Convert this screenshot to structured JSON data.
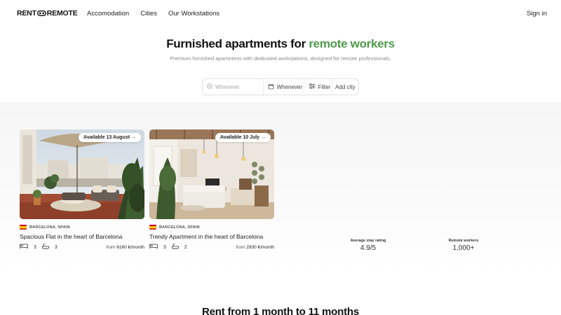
{
  "brand": {
    "left": "RENT",
    "right": "REMOTE"
  },
  "nav": {
    "links": [
      "Accomodation",
      "Cities",
      "Our Workstations"
    ],
    "signin": "Sign in"
  },
  "hero": {
    "title_prefix": "Furnished apartments for ",
    "title_accent": "remote workers",
    "subtitle": "Premium furnished apartments with dedicated workstations, designed for remote professionals.",
    "accent_color": "#4f9a4a"
  },
  "search": {
    "where_placeholder": "Wherever",
    "when_label": "Whenever",
    "filter_label": "Filter",
    "add_city_label": "Add city"
  },
  "listings": [
    {
      "badge": "Available 13 August →",
      "location": "BARCELONA, SPAIN",
      "title": "Spacious Flat in the heart of Barcelona",
      "beds": "3",
      "baths": "3",
      "price_prefix": "from ",
      "price": "6160 €/month"
    },
    {
      "badge": "Available 10 July →",
      "location": "BARCELONA, SPAIN",
      "title": "Trendy Apartment in the heart of Barcelona",
      "beds": "3",
      "baths": "2",
      "price_prefix": "from ",
      "price": "2930 €/month"
    }
  ],
  "stats": [
    {
      "label": "Average stay rating",
      "value": "4.9/5"
    },
    {
      "label": "Remote workers",
      "value": "1,000+"
    }
  ],
  "section_title": "Rent from 1 month to 11 months"
}
